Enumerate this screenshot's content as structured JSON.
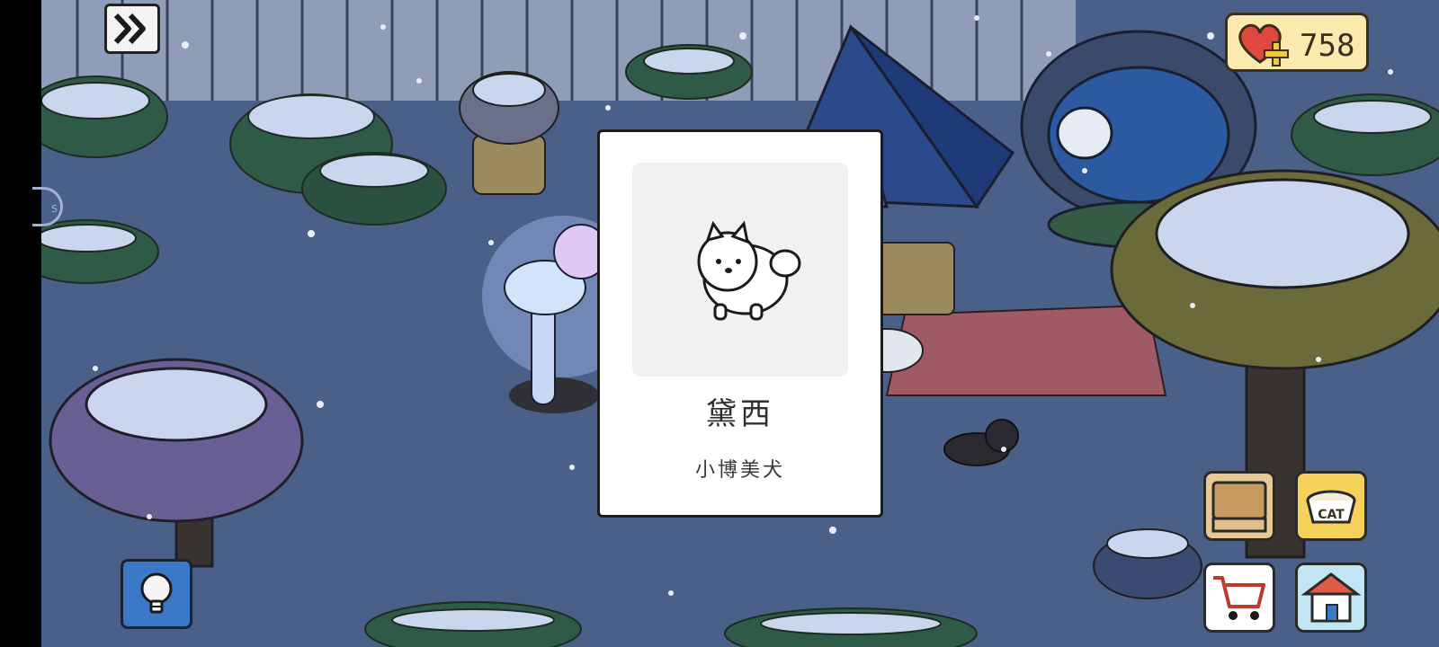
{
  "hud": {
    "fast_forward_icon": "double-chevron-right-icon",
    "currency": {
      "icon": "heart-plus-icon",
      "value": "758"
    },
    "side_tab_text": "S",
    "hint_icon": "lightbulb-icon",
    "box_icon": "cardboard-box-icon",
    "food_bowl_label": "CAT",
    "shop_icon": "shopping-cart-icon",
    "home_icon": "house-icon"
  },
  "dialog": {
    "name": "黛西",
    "breed": "小博美犬",
    "portrait_icon": "pomeranian-dog-icon"
  },
  "colors": {
    "background_night": "#4a5f86",
    "snow": "#c9d6ee",
    "card": "#ffffff",
    "hint_button": "#3b78c8",
    "currency_badge": "#fbe9ad"
  }
}
